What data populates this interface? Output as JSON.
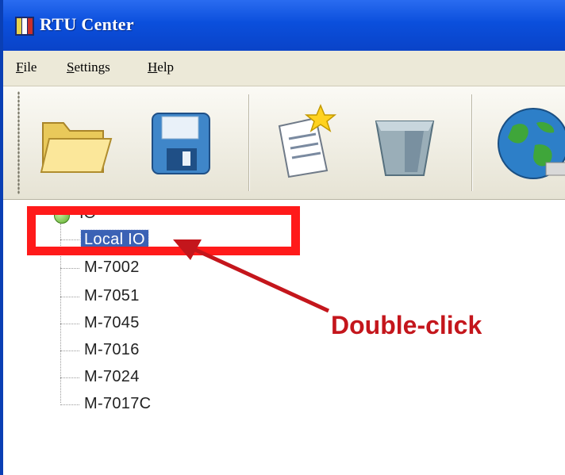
{
  "window": {
    "title": "RTU Center",
    "app_icon": "rtu-app-icon"
  },
  "menubar": {
    "items": [
      {
        "label": "File",
        "mnemonic": "F",
        "rest": "ile"
      },
      {
        "label": "Settings",
        "mnemonic": "S",
        "rest": "ettings"
      },
      {
        "label": "Help",
        "mnemonic": "H",
        "rest": "elp"
      }
    ]
  },
  "toolbar": {
    "buttons": [
      {
        "icon": "open-folder-icon"
      },
      {
        "icon": "save-floppy-icon"
      },
      {
        "icon": "new-document-icon"
      },
      {
        "icon": "delete-trash-icon"
      },
      {
        "icon": "network-globe-icon"
      }
    ]
  },
  "tree": {
    "root_label": "IO",
    "nodes": [
      {
        "label": "Local IO",
        "selected": true
      },
      {
        "label": "M-7002",
        "selected": false
      },
      {
        "label": "M-7051",
        "selected": false
      },
      {
        "label": "M-7045",
        "selected": false
      },
      {
        "label": "M-7016",
        "selected": false
      },
      {
        "label": "M-7024",
        "selected": false
      },
      {
        "label": "M-7017C",
        "selected": false
      }
    ]
  },
  "annotation": {
    "callout_text": "Double-click",
    "color": "#c4161c",
    "box_color": "#ff1a1a"
  }
}
